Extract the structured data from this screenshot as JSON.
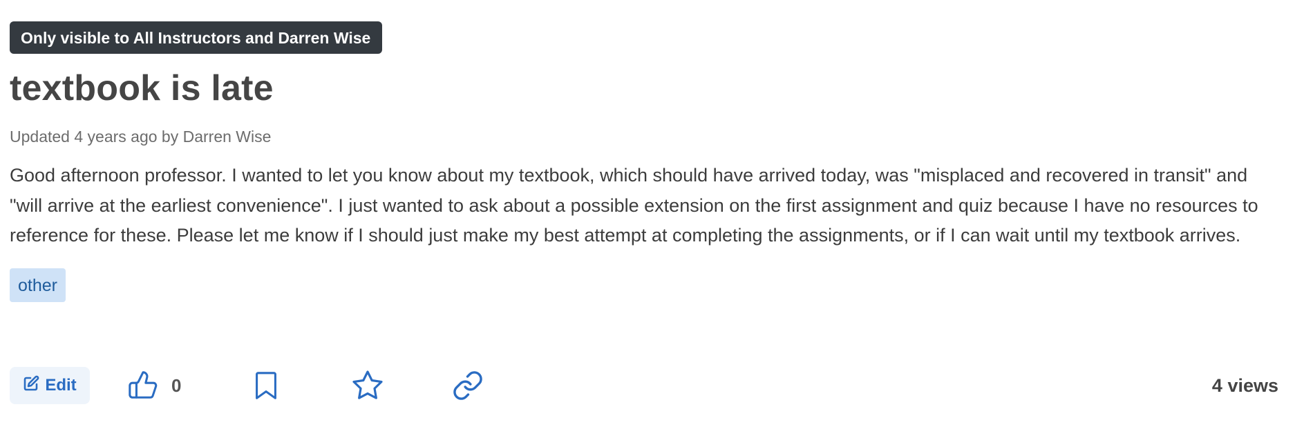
{
  "post": {
    "visibility": "Only visible to All Instructors and Darren Wise",
    "title": "textbook is late",
    "meta": "Updated 4 years ago by Darren Wise",
    "body": "Good afternoon professor. I wanted to let you know about my textbook, which should have arrived today, was \"misplaced and recovered in transit\" and \"will arrive at the earliest convenience\". I just wanted to ask about a possible extension on the first assignment and quiz because I have no resources to reference for these. Please let me know if I should just make my best attempt at completing the assignments, or if I can wait until my textbook arrives.",
    "tags": [
      "other"
    ]
  },
  "actions": {
    "edit_label": "Edit",
    "like_count": "0",
    "views": "4 views"
  },
  "icons": {
    "edit": "edit-icon",
    "like": "thumbs-up-icon",
    "bookmark": "bookmark-icon",
    "star": "star-icon",
    "link": "link-icon"
  },
  "colors": {
    "accent": "#2a6cc2",
    "badge_bg": "#343a40",
    "tag_bg": "#cfe2f7",
    "tag_text": "#1f5c9c",
    "edit_bg": "#eef4fb"
  }
}
